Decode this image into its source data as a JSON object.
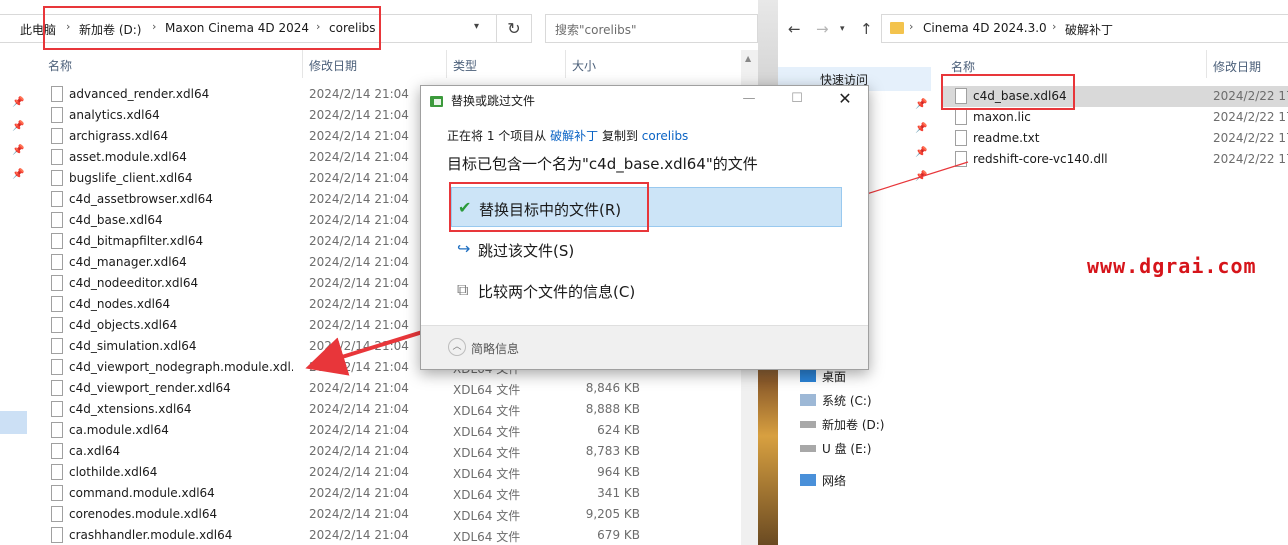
{
  "left": {
    "breadcrumb": [
      "此电脑",
      "新加卷 (D:)",
      "Maxon Cinema 4D 2024",
      "corelibs"
    ],
    "search_placeholder": "搜索\"corelibs\"",
    "columns": {
      "name": "名称",
      "date": "修改日期",
      "type": "类型",
      "size": "大小"
    },
    "files": [
      {
        "name": "advanced_render.xdl64",
        "date": "2024/2/14 21:04",
        "type": "",
        "size": ""
      },
      {
        "name": "analytics.xdl64",
        "date": "2024/2/14 21:04",
        "type": "",
        "size": ""
      },
      {
        "name": "archigrass.xdl64",
        "date": "2024/2/14 21:04",
        "type": "",
        "size": ""
      },
      {
        "name": "asset.module.xdl64",
        "date": "2024/2/14 21:04",
        "type": "",
        "size": ""
      },
      {
        "name": "bugslife_client.xdl64",
        "date": "2024/2/14 21:04",
        "type": "",
        "size": ""
      },
      {
        "name": "c4d_assetbrowser.xdl64",
        "date": "2024/2/14 21:04",
        "type": "",
        "size": ""
      },
      {
        "name": "c4d_base.xdl64",
        "date": "2024/2/14 21:04",
        "type": "",
        "size": ""
      },
      {
        "name": "c4d_bitmapfilter.xdl64",
        "date": "2024/2/14 21:04",
        "type": "",
        "size": ""
      },
      {
        "name": "c4d_manager.xdl64",
        "date": "2024/2/14 21:04",
        "type": "",
        "size": ""
      },
      {
        "name": "c4d_nodeeditor.xdl64",
        "date": "2024/2/14 21:04",
        "type": "",
        "size": ""
      },
      {
        "name": "c4d_nodes.xdl64",
        "date": "2024/2/14 21:04",
        "type": "",
        "size": ""
      },
      {
        "name": "c4d_objects.xdl64",
        "date": "2024/2/14 21:04",
        "type": "",
        "size": ""
      },
      {
        "name": "c4d_simulation.xdl64",
        "date": "2024/2/14 21:04",
        "type": "",
        "size": ""
      },
      {
        "name": "c4d_viewport_nodegraph.module.xdl...",
        "date": "2024/2/14 21:04",
        "type": "XDL64 文件",
        "size": ""
      },
      {
        "name": "c4d_viewport_render.xdl64",
        "date": "2024/2/14 21:04",
        "type": "XDL64 文件",
        "size": "8,846 KB"
      },
      {
        "name": "c4d_xtensions.xdl64",
        "date": "2024/2/14 21:04",
        "type": "XDL64 文件",
        "size": "8,888 KB"
      },
      {
        "name": "ca.module.xdl64",
        "date": "2024/2/14 21:04",
        "type": "XDL64 文件",
        "size": "624 KB"
      },
      {
        "name": "ca.xdl64",
        "date": "2024/2/14 21:04",
        "type": "XDL64 文件",
        "size": "8,783 KB"
      },
      {
        "name": "clothilde.xdl64",
        "date": "2024/2/14 21:04",
        "type": "XDL64 文件",
        "size": "964 KB"
      },
      {
        "name": "command.module.xdl64",
        "date": "2024/2/14 21:04",
        "type": "XDL64 文件",
        "size": "341 KB"
      },
      {
        "name": "corenodes.module.xdl64",
        "date": "2024/2/14 21:04",
        "type": "XDL64 文件",
        "size": "9,205 KB"
      },
      {
        "name": "crashhandler.module.xdl64",
        "date": "2024/2/14 21:04",
        "type": "XDL64 文件",
        "size": "679 KB"
      }
    ]
  },
  "right": {
    "breadcrumb": [
      "Cinema 4D 2024.3.0",
      "破解补丁"
    ],
    "columns": {
      "name": "名称",
      "date": "修改日期"
    },
    "nav": {
      "quick_access": "快速访问",
      "desktop": "桌面",
      "drive_c": "系统 (C:)",
      "drive_d": "新加卷 (D:)",
      "drive_e": "U 盘 (E:)",
      "network": "网络"
    },
    "files": [
      {
        "name": "c4d_base.xdl64",
        "date": "2024/2/22 17"
      },
      {
        "name": "maxon.lic",
        "date": "2024/2/22 17"
      },
      {
        "name": "readme.txt",
        "date": "2024/2/22 17"
      },
      {
        "name": "redshift-core-vc140.dll",
        "date": "2024/2/22 17"
      }
    ]
  },
  "dialog": {
    "title": "替换或跳过文件",
    "line1_prefix": "正在将 1 个项目从",
    "line1_src": "破解补丁",
    "line1_mid": "复制到",
    "line1_dst": "corelibs",
    "line2": "目标已包含一个名为\"c4d_base.xdl64\"的文件",
    "options": {
      "replace": "替换目标中的文件(R)",
      "skip": "跳过该文件(S)",
      "compare": "比较两个文件的信息(C)"
    },
    "less_info": "简略信息"
  },
  "watermark": "www.dgrai.com",
  "colors": {
    "highlight_box": "#e8363a",
    "link": "#0a63c4",
    "selection": "#cce4f7"
  }
}
